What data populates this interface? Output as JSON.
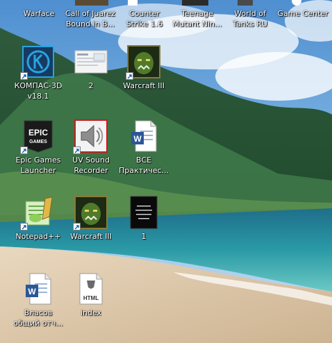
{
  "desktop": {
    "top_row": [
      {
        "label": "Warface",
        "icon": "warface-icon"
      },
      {
        "label": "Call of Juarez\nBound in B...",
        "icon": "call-of-juarez-icon"
      },
      {
        "label": "Counter\nStrike 1.6",
        "icon": "counter-strike-icon"
      },
      {
        "label": "Teenage\nMutant Nin...",
        "icon": "tmnt-icon"
      },
      {
        "label": "World of\nTanks RU",
        "icon": "world-of-tanks-icon"
      },
      {
        "label": "Game Center",
        "icon": "game-center-icon"
      }
    ],
    "icons": [
      {
        "label": "КОМПАС-3D\nv18.1",
        "icon": "kompas-3d-icon",
        "shortcut": true
      },
      {
        "label": "2",
        "icon": "image-thumbnail-icon",
        "shortcut": false
      },
      {
        "label": "Warcraft III",
        "icon": "warcraft-icon",
        "shortcut": true
      },
      {
        "label": "Epic Games\nLauncher",
        "icon": "epic-games-icon",
        "shortcut": true,
        "logo_text": "EPIC\nGAMES"
      },
      {
        "label": "UV Sound\nRecorder",
        "icon": "speaker-icon",
        "shortcut": true
      },
      {
        "label": "ВСЕ\nПрактичес...",
        "icon": "word-document-icon",
        "shortcut": false
      },
      {
        "label": "Notepad++",
        "icon": "notepad-plus-plus-icon",
        "shortcut": true
      },
      {
        "label": "Warcraft III",
        "icon": "warcraft-icon",
        "shortcut": true
      },
      {
        "label": "1",
        "icon": "image-thumbnail-icon",
        "shortcut": false
      },
      {
        "label": "Власов\nобщий отч...",
        "icon": "word-document-icon",
        "shortcut": false
      },
      {
        "label": "index",
        "icon": "html-file-icon",
        "shortcut": false,
        "file_tag": "HTML"
      }
    ]
  }
}
